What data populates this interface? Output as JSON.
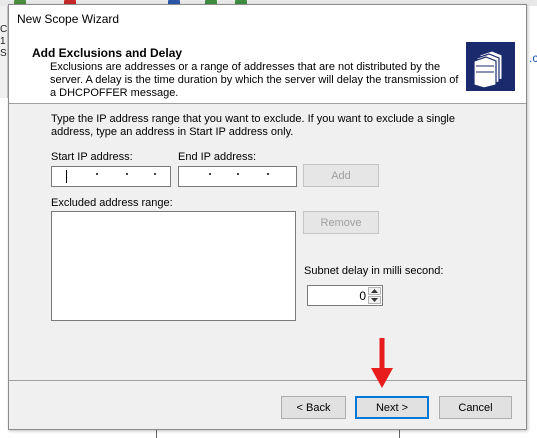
{
  "background": {
    "left_text": [
      "CP",
      "1",
      "S"
    ],
    "right_text": ".co"
  },
  "dialog": {
    "title": "New Scope Wizard",
    "header": {
      "title": "Add Exclusions and Delay",
      "description": "Exclusions are addresses or a range of addresses that are not distributed by the server. A delay is the time duration by which the server will delay the transmission of a DHCPOFFER message.",
      "icon": "folders-icon"
    },
    "instructions": "Type the IP address range that you want to exclude. If you want to exclude a single address, type an address in Start IP address only.",
    "start_ip": {
      "label": "Start IP address:",
      "value": ". . ."
    },
    "end_ip": {
      "label": "End IP address:",
      "value": ". . ."
    },
    "add_button": "Add",
    "excluded_label": "Excluded address range:",
    "excluded_items": [],
    "remove_button": "Remove",
    "subnet_delay": {
      "label": "Subnet delay in milli second:",
      "value": "0"
    },
    "footer": {
      "back": "< Back",
      "next": "Next >",
      "cancel": "Cancel"
    }
  },
  "annotation": {
    "arrow_color": "#e81c1c"
  },
  "colors": {
    "accent": "#0078d7",
    "dialog_bg": "#f0f0f0",
    "header_bg": "#ffffff"
  }
}
